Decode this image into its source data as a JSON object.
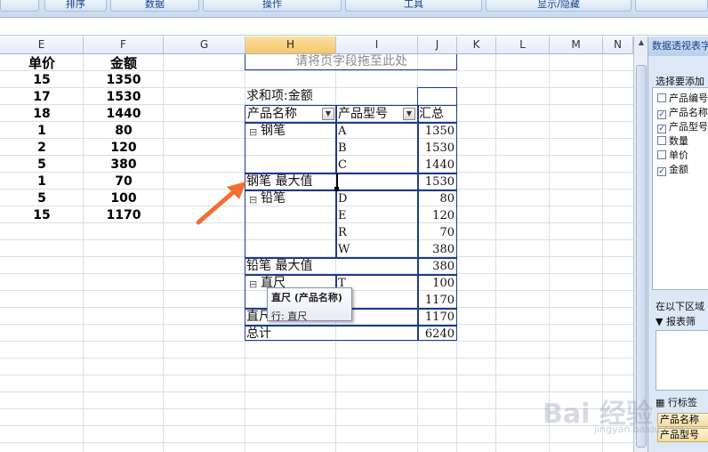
{
  "ribbon": {
    "groups": [
      "排序",
      "数据",
      "操作",
      "工具",
      "显示/隐藏"
    ]
  },
  "columns": [
    "E",
    "F",
    "G",
    "H",
    "I",
    "J",
    "K",
    "L",
    "M",
    "N"
  ],
  "source_headers": {
    "price": "单价",
    "amount": "金额"
  },
  "source_rows": [
    {
      "price": "15",
      "amount": "1350"
    },
    {
      "price": "17",
      "amount": "1530"
    },
    {
      "price": "18",
      "amount": "1440"
    },
    {
      "price": "1",
      "amount": "80"
    },
    {
      "price": "2",
      "amount": "120"
    },
    {
      "price": "5",
      "amount": "380"
    },
    {
      "price": "1",
      "amount": "70"
    },
    {
      "price": "5",
      "amount": "100"
    },
    {
      "price": "15",
      "amount": "1170"
    }
  ],
  "pivot": {
    "page_drop_hint": "请将页字段拖至此处",
    "value_label": "求和项:金额",
    "row_field_1": "产品名称",
    "row_field_2": "产品型号",
    "total_header": "汇总",
    "group1": {
      "name": "钢笔",
      "items": [
        {
          "code": "A",
          "value": "1350"
        },
        {
          "code": "B",
          "value": "1530"
        },
        {
          "code": "C",
          "value": "1440"
        }
      ],
      "subtotal_label": "钢笔 最大值",
      "subtotal_value": "1530"
    },
    "group2": {
      "name": "铅笔",
      "items": [
        {
          "code": "D",
          "value": "80"
        },
        {
          "code": "E",
          "value": "120"
        },
        {
          "code": "R",
          "value": "70"
        },
        {
          "code": "W",
          "value": "380"
        }
      ],
      "subtotal_label": "铅笔 最大值",
      "subtotal_value": "380"
    },
    "group3": {
      "name": "直尺",
      "items": [
        {
          "code": "T",
          "value": "100"
        },
        {
          "code": "",
          "value": "1170"
        }
      ],
      "subtotal_label": "直尺",
      "subtotal_value": "1170"
    },
    "grand_total_label": "总计",
    "grand_total_value": "6240",
    "collapse_glyph": "⊟"
  },
  "tooltip": {
    "title": "直尺 (产品名称)",
    "line": "行: 直尺"
  },
  "panel": {
    "title": "数据透视表字",
    "choose_label": "选择要添加",
    "fields": [
      {
        "label": "产品编号",
        "checked": false
      },
      {
        "label": "产品名称",
        "checked": true
      },
      {
        "label": "产品型号",
        "checked": true
      },
      {
        "label": "数量",
        "checked": false
      },
      {
        "label": "单价",
        "checked": false
      },
      {
        "label": "金额",
        "checked": true
      }
    ],
    "area_label": "在以下区域",
    "report_filter_label": "报表筛",
    "row_labels_label": "行标签",
    "row_items": [
      "产品名称",
      "产品型号"
    ]
  },
  "watermark": {
    "main": "Bai 经验",
    "sub": "jingyan.baidu.com"
  },
  "colors": {
    "pivot_border": "#1f3a8a",
    "arrow": "#f07030",
    "selected_header": "#f5c66a"
  }
}
